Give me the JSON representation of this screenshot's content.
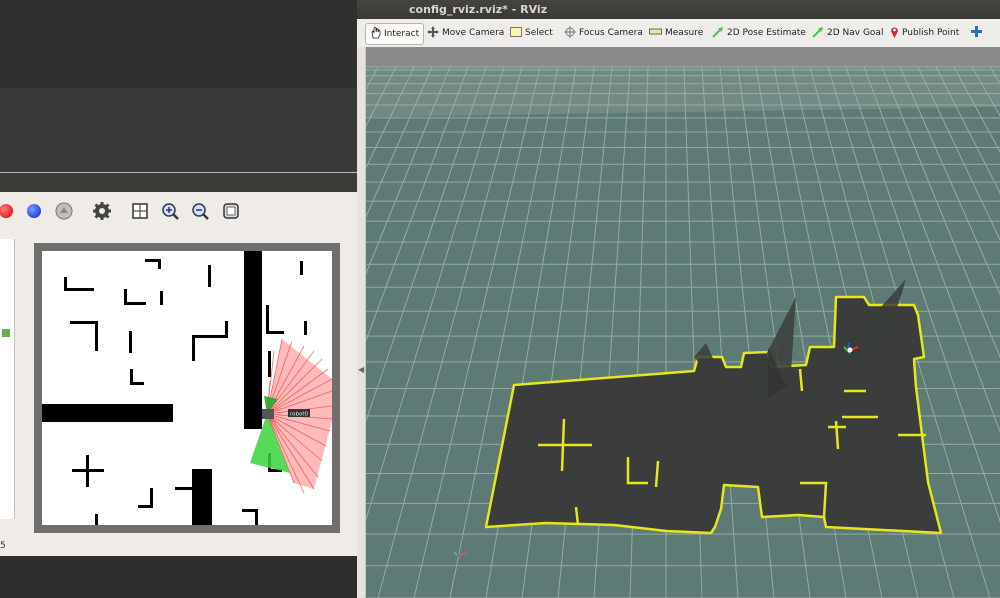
{
  "rviz": {
    "title": "config_rviz.rviz* - RViz",
    "tools": [
      {
        "label": "Interact",
        "icon": "hand-icon",
        "active": true
      },
      {
        "label": "Move Camera",
        "icon": "move-camera-icon",
        "active": false
      },
      {
        "label": "Select",
        "icon": "select-icon",
        "active": false
      },
      {
        "label": "Focus Camera",
        "icon": "focus-camera-icon",
        "active": false
      },
      {
        "label": "Measure",
        "icon": "measure-icon",
        "active": false
      },
      {
        "label": "2D Pose Estimate",
        "icon": "pose-estimate-icon",
        "active": false
      },
      {
        "label": "2D Nav Goal",
        "icon": "nav-goal-icon",
        "active": false
      },
      {
        "label": "Publish Point",
        "icon": "publish-point-icon",
        "active": false
      }
    ],
    "colors": {
      "grid": "#8fa8a2",
      "floor": "#5e7a74",
      "map_fill": "#3a3d3b",
      "map_outline": "#e6e61c"
    }
  },
  "stage": {
    "toolbar_icons": [
      "record-red-icon",
      "record-blue-icon",
      "camera-icon",
      "gear-icon",
      "grid-icon",
      "zoom-in-icon",
      "zoom-out-icon",
      "fit-view-icon"
    ],
    "robot_label": "robot0",
    "status_text": "5",
    "colors": {
      "laser": "#ff3b3b",
      "fov": "#3ad43a",
      "walls": "#000000",
      "floor": "#ffffff"
    }
  }
}
